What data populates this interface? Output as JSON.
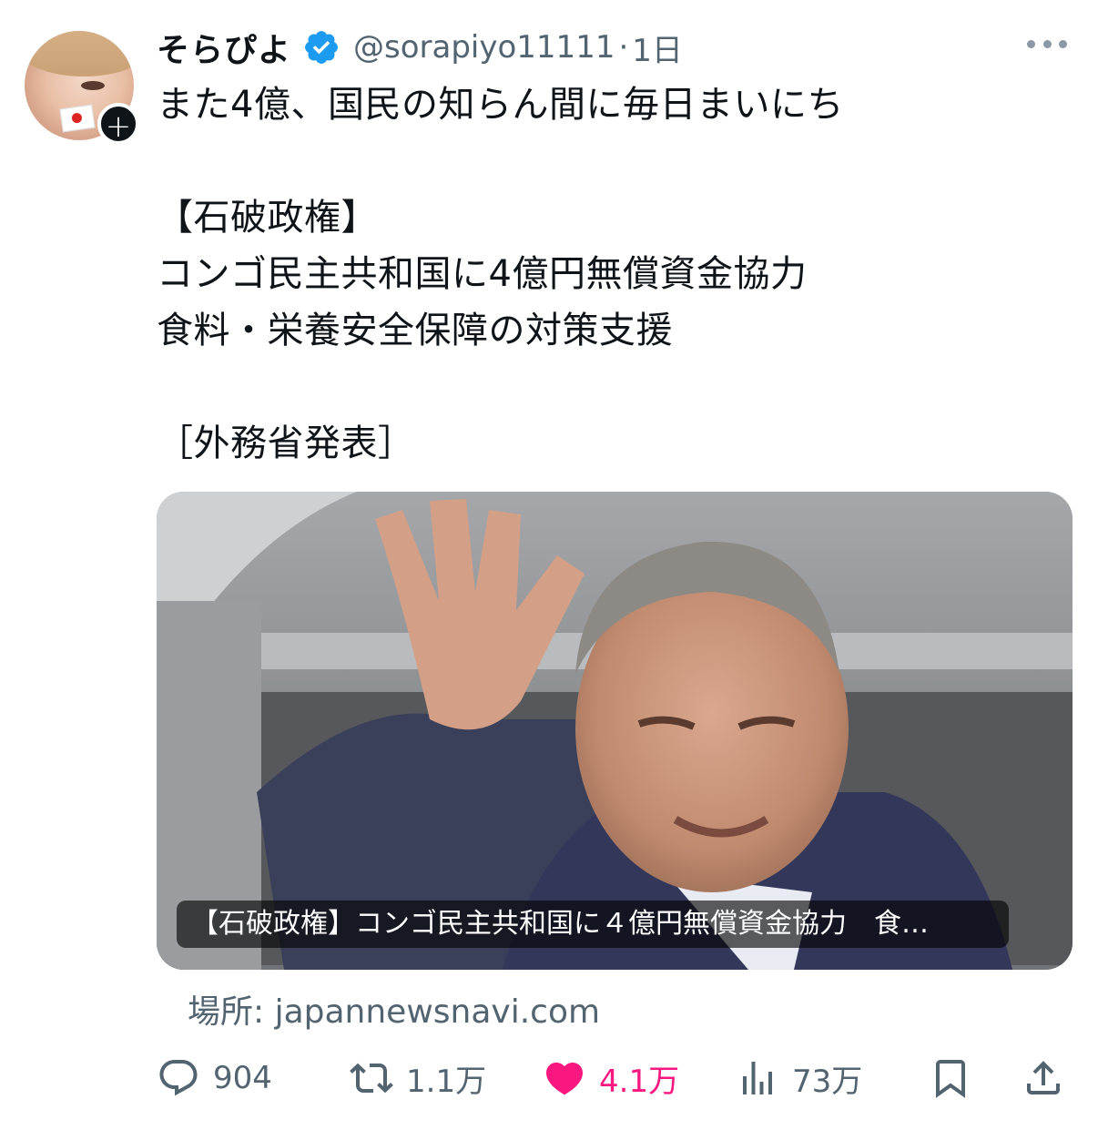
{
  "tweet": {
    "display_name": "そらぴよ",
    "handle": "@sorapiyo11111",
    "separator": "·",
    "time": "1日",
    "text": "また4億、国民の知らん間に毎日まいにち\n\n【石破政権】\nコンゴ民主共和国に4億円無償資金協力\n食料・栄養安全保障の対策支援\n\n［外務省発表］",
    "follow_plus": "+"
  },
  "card": {
    "caption": "【石破政権】コンゴ民主共和国に４億円無償資金協力　食…",
    "source": "場所: japannewsnavi.com"
  },
  "actions": {
    "reply_count": "904",
    "retweet_count": "1.1万",
    "like_count": "4.1万",
    "views_count": "73万"
  },
  "colors": {
    "text": "#0f1419",
    "secondary": "#536471",
    "verified": "#1d9bf0",
    "like": "#f91880"
  },
  "icons": [
    "verified-badge-icon",
    "more-icon",
    "reply-icon",
    "retweet-icon",
    "like-icon",
    "views-icon",
    "bookmark-icon",
    "share-icon"
  ]
}
